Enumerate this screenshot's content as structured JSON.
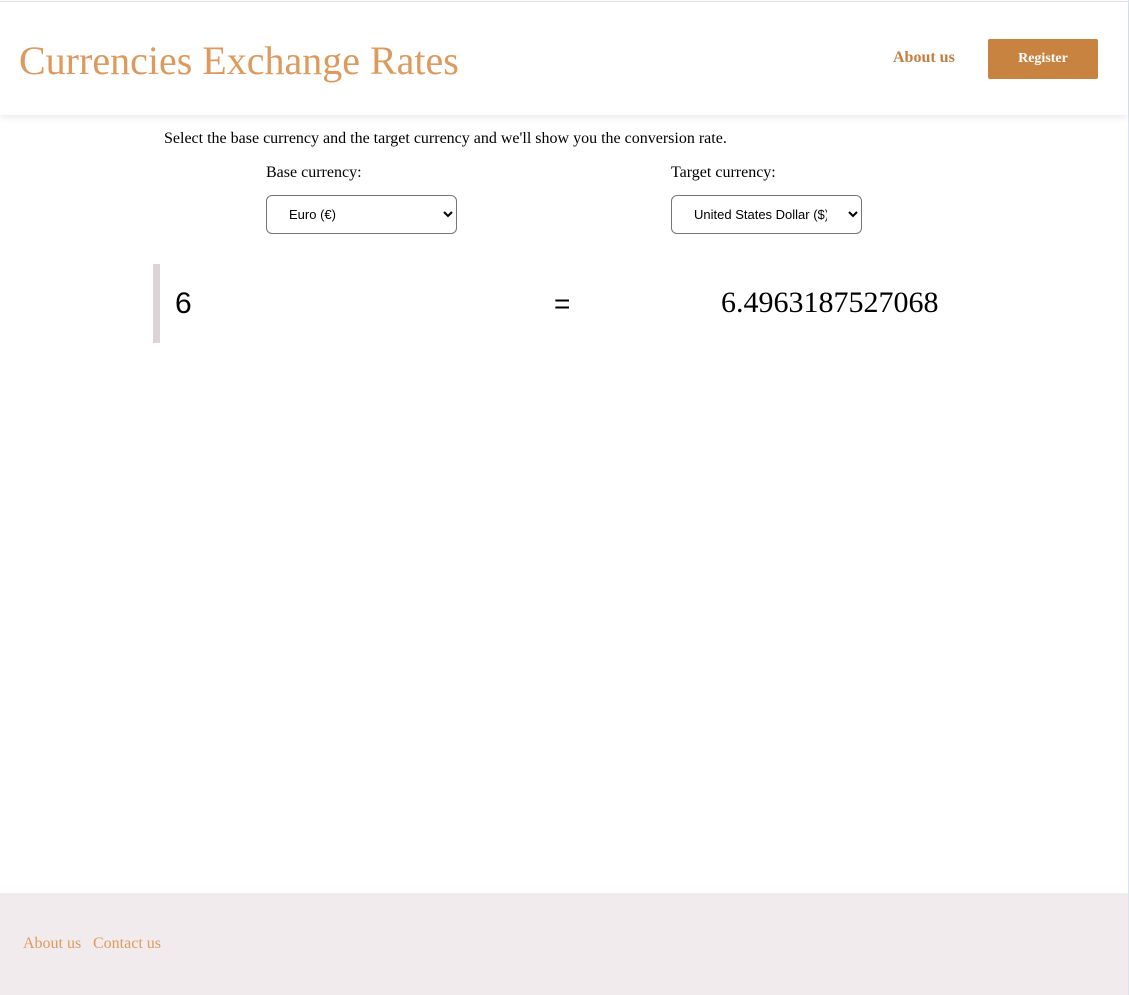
{
  "header": {
    "title": "Currencies Exchange Rates",
    "about_label": "About us",
    "register_label": "Register"
  },
  "main": {
    "intro": "Select the base currency and the target currency and we'll show you the conversion rate.",
    "base_label": "Base currency:",
    "base_value": "Euro (€)",
    "target_label": "Target currency:",
    "target_value": "United States Dollar ($)",
    "amount": "6",
    "equals": "=",
    "result": "6.4963187527068"
  },
  "footer": {
    "links": [
      {
        "label": "About us"
      },
      {
        "label": "Contact us"
      }
    ]
  }
}
